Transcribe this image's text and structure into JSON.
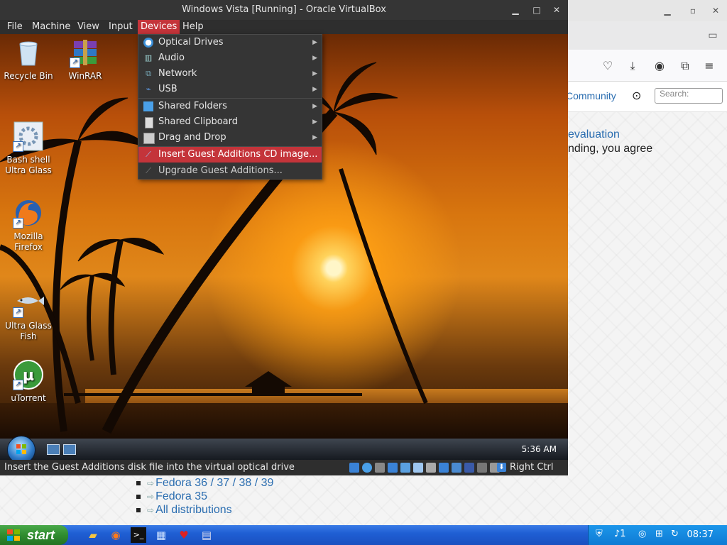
{
  "vbox": {
    "title": "Windows Vista [Running] - Oracle VirtualBox",
    "window_buttons": {
      "minimize": "▁",
      "maximize": "□",
      "close": "✕"
    },
    "menus": [
      "File",
      "Machine",
      "View",
      "Input",
      "Devices",
      "Help"
    ],
    "active_menu": "Devices",
    "devices_menu": {
      "items": [
        {
          "label": "Optical Drives",
          "icon": "disc-icon",
          "submenu": true
        },
        {
          "label": "Audio",
          "icon": "audio-icon",
          "submenu": true
        },
        {
          "label": "Network",
          "icon": "network-icon",
          "submenu": true
        },
        {
          "label": "USB",
          "icon": "usb-icon",
          "submenu": true
        },
        {
          "label": "Shared Folders",
          "icon": "folder-icon",
          "submenu": true
        },
        {
          "label": "Shared Clipboard",
          "icon": "clipboard-icon",
          "submenu": true
        },
        {
          "label": "Drag and Drop",
          "icon": "drag-drop-icon",
          "submenu": true
        },
        {
          "label": "Insert Guest Additions CD image...",
          "icon": "wand-icon",
          "highlighted": true
        },
        {
          "label": "Upgrade Guest Additions...",
          "icon": "wand-icon",
          "disabled": true
        }
      ]
    },
    "status_text": "Insert the Guest Additions disk file into the virtual optical drive",
    "host_key": "Right Ctrl",
    "colors": {
      "highlight": "#c4343a",
      "menu_bg": "#353535",
      "text": "#e6e6e6"
    }
  },
  "guest": {
    "desktop_icons": [
      {
        "label": "Recycle Bin",
        "icon": "recycle-bin-icon",
        "shortcut": false
      },
      {
        "label": "WinRAR",
        "icon": "winrar-icon",
        "shortcut": true
      },
      {
        "label": "Bash shell Ultra Glass",
        "icon": "bash-shell-icon",
        "shortcut": true
      },
      {
        "label": "Mozilla Firefox",
        "icon": "firefox-icon",
        "shortcut": true
      },
      {
        "label": "Ultra Glass Fish",
        "icon": "fish-icon",
        "shortcut": true
      },
      {
        "label": "uTorrent",
        "icon": "utorrent-icon",
        "shortcut": true
      }
    ],
    "clock": "5:36 AM"
  },
  "firefox_bg": {
    "community_link": "Community",
    "search_placeholder": "Search:",
    "heading_fragment": "evaluation",
    "text_fragment": "nding, you agree",
    "distro_links": [
      "Fedora 36 / 37 / 38 / 39",
      "Fedora 35",
      "All distributions"
    ]
  },
  "host_taskbar": {
    "start_label": "start",
    "clock": "08:37",
    "tray_count": "1",
    "colors": {
      "taskbar": "#1f5fd4",
      "start": "#2f8c2f",
      "tray": "#0f7bd4"
    }
  }
}
